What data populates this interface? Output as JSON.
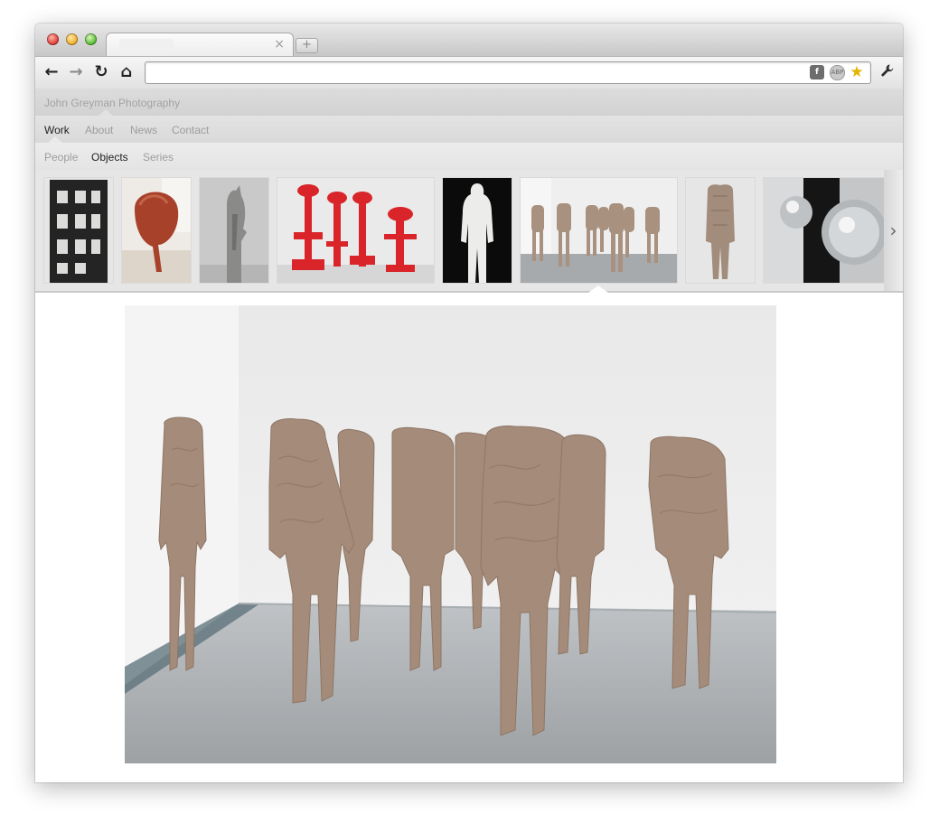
{
  "browser": {
    "tab_title": "",
    "tab_close_icon": "close-icon",
    "new_tab_label": "+",
    "address_value": "",
    "toolbar": {
      "back_icon": "←",
      "forward_icon": "→",
      "reload_icon": "↻",
      "home_icon": "⌂",
      "flash_icon": "f",
      "abp_icon": "ABP",
      "bookmark_icon": "★",
      "settings_icon": "🔧"
    }
  },
  "site": {
    "title": "John Greyman Photography",
    "main_nav": [
      {
        "label": "Work",
        "active": true
      },
      {
        "label": "About",
        "active": false
      },
      {
        "label": "News",
        "active": false
      },
      {
        "label": "Contact",
        "active": false
      }
    ],
    "sub_nav": [
      {
        "label": "People",
        "active": false
      },
      {
        "label": "Objects",
        "active": true
      },
      {
        "label": "Series",
        "active": false
      }
    ],
    "thumbnails": [
      {
        "name": "thumb-dark-grid-sculpture",
        "selected": false
      },
      {
        "name": "thumb-red-head-sculpture",
        "selected": false
      },
      {
        "name": "thumb-grey-figure-sculpture",
        "selected": false
      },
      {
        "name": "thumb-red-stands-sculpture",
        "selected": false
      },
      {
        "name": "thumb-white-silhouette",
        "selected": false
      },
      {
        "name": "thumb-headless-figures-gallery",
        "selected": true
      },
      {
        "name": "thumb-single-headless-figure",
        "selected": false
      },
      {
        "name": "thumb-chrome-spheres",
        "selected": false
      }
    ],
    "strip_next_icon": "›",
    "colors": {
      "active_nav": "#222222",
      "inactive_nav": "#9d9d9d",
      "accent_red": "#d9252a"
    }
  }
}
